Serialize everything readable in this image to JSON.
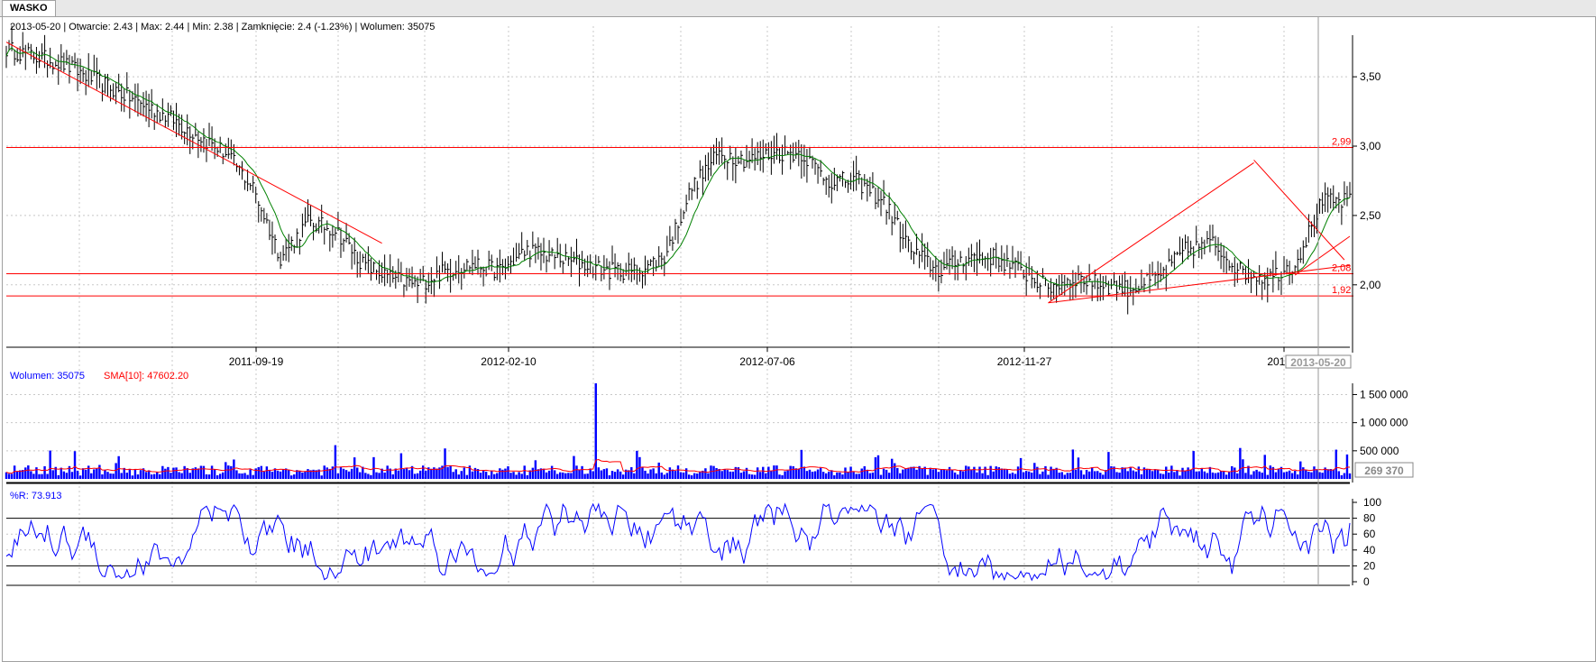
{
  "tab": {
    "label": "WASKO"
  },
  "info_line": "2013-05-20 | Otwarcie: 2.43 | Max: 2.44 | Min: 2.38 | Zamknięcie: 2.4 (-1.23%)  | Wolumen: 35075",
  "volume_header": {
    "volume_label": "Wolumen: 35075",
    "sma_label": "SMA[10]: 47602.20"
  },
  "wr_header": "%R: 73.913",
  "last_volume_tag": "269 370",
  "cursor_date_tag": "2013-05-20",
  "colors": {
    "price": "#000000",
    "ma": "#008000",
    "trend": "#ff0000",
    "volume": "#0000ff",
    "volume_sma": "#ff0000",
    "wr": "#0000ff",
    "grid": "#c8c8c8"
  },
  "chart_data": [
    {
      "type": "line",
      "title": "",
      "x_tick_labels": [
        "2011-09-19",
        "2012-02-10",
        "2012-07-06",
        "2012-11-27",
        "2013-0"
      ],
      "y_tick_labels": [
        "2,00",
        "2,50",
        "3,00",
        "3,50"
      ],
      "ylim": [
        1.55,
        3.8
      ],
      "level_lines": [
        {
          "value": 2.99,
          "label": "2,99"
        },
        {
          "value": 2.08,
          "label": "2,08"
        },
        {
          "value": 1.92,
          "label": "1,92"
        }
      ],
      "series": [
        {
          "name": "",
          "x": [
            0,
            20,
            40,
            60,
            80,
            90,
            100,
            110,
            120,
            130,
            140,
            150,
            160,
            170,
            180,
            190,
            200,
            210,
            220,
            230,
            240,
            250,
            260,
            270,
            280,
            290,
            300,
            310,
            320,
            330,
            340,
            350,
            360,
            370,
            380,
            390,
            400,
            410,
            420,
            430,
            440,
            450,
            460,
            470,
            480,
            490
          ],
          "values": [
            3.7,
            3.6,
            3.4,
            3.2,
            2.95,
            2.7,
            2.2,
            2.45,
            2.4,
            2.15,
            2.05,
            2.0,
            2.1,
            2.15,
            2.1,
            2.25,
            2.2,
            2.15,
            2.1,
            2.1,
            2.2,
            2.7,
            2.95,
            2.9,
            2.95,
            2.95,
            2.75,
            2.75,
            2.6,
            2.25,
            2.1,
            2.2,
            2.2,
            2.1,
            1.98,
            2.05,
            2.0,
            1.97,
            2.05,
            2.25,
            2.3,
            2.1,
            2.05,
            2.15,
            2.6,
            2.6
          ]
        }
      ]
    },
    {
      "type": "bar",
      "title": "",
      "y_tick_labels": [
        "500 000",
        "1 000 000",
        "1 500 000"
      ],
      "ylim": [
        0,
        1700000
      ],
      "spikes": [
        {
          "x": 215,
          "value": 1700000
        },
        {
          "x": 120,
          "value": 600000
        },
        {
          "x": 230,
          "value": 500000
        },
        {
          "x": 450,
          "value": 550000
        },
        {
          "x": 485,
          "value": 520000
        }
      ]
    },
    {
      "type": "line",
      "title": "",
      "y_tick_labels": [
        "0",
        "20",
        "40",
        "60",
        "80",
        "100"
      ],
      "ylim": [
        0,
        100
      ],
      "reference_lines": [
        20,
        80
      ],
      "series": [
        {
          "name": "",
          "last_value": 73.913
        }
      ]
    }
  ]
}
